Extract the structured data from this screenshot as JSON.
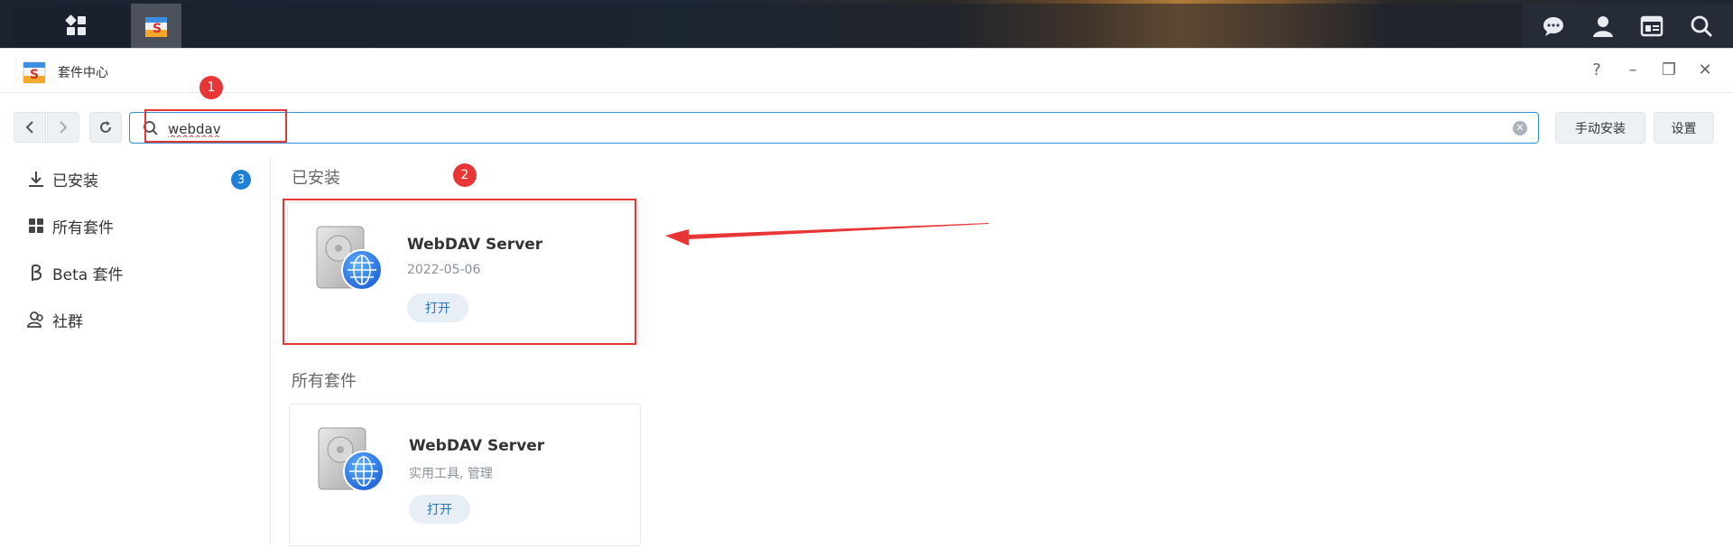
{
  "app": {
    "title": "套件中心"
  },
  "taskbar": {
    "icons": [
      "main-menu-icon",
      "package-center-icon",
      "chat-icon",
      "user-icon",
      "widgets-icon",
      "search-icon"
    ]
  },
  "window_controls": {
    "help": "?",
    "minimize": "–",
    "maximize": "❐",
    "close": "✕"
  },
  "toolbar": {
    "search_value": "webdav",
    "manual_install_label": "手动安装",
    "settings_label": "设置"
  },
  "sidebar": {
    "items": [
      {
        "label": "已安装",
        "icon": "download-icon",
        "badge": "3"
      },
      {
        "label": "所有套件",
        "icon": "grid-icon"
      },
      {
        "label": "Beta 套件",
        "icon": "beta-icon"
      },
      {
        "label": "社群",
        "icon": "community-icon"
      }
    ]
  },
  "main": {
    "installed_title": "已安装",
    "all_title": "所有套件",
    "installed_card": {
      "name": "WebDAV Server",
      "sub": "2022-05-06",
      "button": "打开"
    },
    "all_card": {
      "name": "WebDAV Server",
      "sub": "实用工具, 管理",
      "button": "打开"
    }
  },
  "annotations": {
    "num1": "1",
    "num2": "2",
    "color": "#e83535"
  }
}
